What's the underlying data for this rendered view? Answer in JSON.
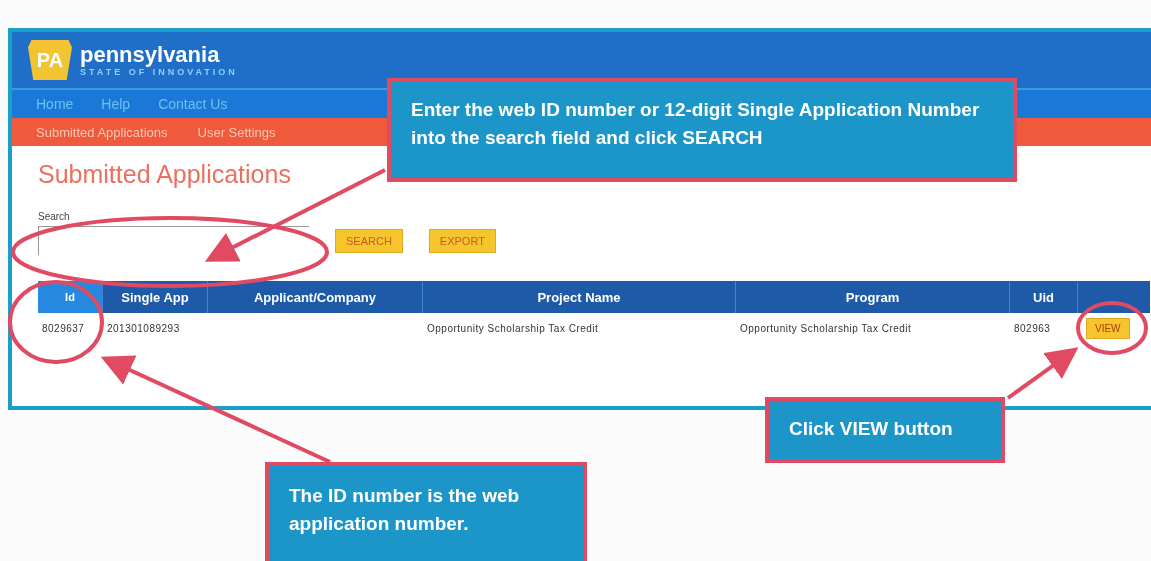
{
  "header": {
    "logo": "PA",
    "brand": "pennsylvania",
    "tagline": "STATE OF INNOVATION"
  },
  "nav": [
    "Home",
    "Help",
    "Contact Us"
  ],
  "subnav": [
    "Submitted Applications",
    "User Settings"
  ],
  "page_title": "Submitted Applications",
  "search": {
    "label": "Search",
    "buttons": [
      "SEARCH",
      "EXPORT"
    ]
  },
  "table": {
    "columns": [
      {
        "label": "Id",
        "selected": true
      },
      {
        "label": "Single App",
        "selected": false
      },
      {
        "label": "Applicant/Company",
        "selected": false
      },
      {
        "label": "Project Name",
        "selected": false
      },
      {
        "label": "Program",
        "selected": false
      },
      {
        "label": "Uid",
        "selected": false
      }
    ],
    "rows": [
      {
        "cells": [
          "8029637",
          "201301089293",
          "",
          "Opportunity Scholarship Tax Credit",
          "Opportunity Scholarship Tax Credit",
          "802963"
        ],
        "action": "VIEW"
      }
    ]
  },
  "callouts": [
    {
      "text": "Enter the web ID number or 12-digit Single Application Number into the search field and click **SEARCH**"
    },
    {
      "text": "Click **VIEW** button"
    },
    {
      "text": "The ID number is the web application number."
    }
  ]
}
